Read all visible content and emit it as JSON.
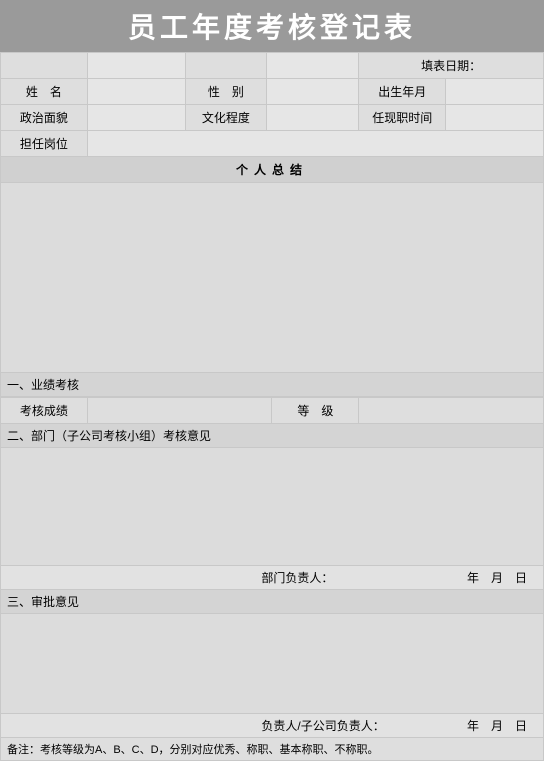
{
  "title": "员工年度考核登记表",
  "fillDateHeader": "填表日期：",
  "info": {
    "nameLabel": "姓　名",
    "genderLabel": "性　别",
    "birthLabel": "出生年月",
    "politicsLabel": "政治面貌",
    "educationLabel": "文化程度",
    "tenureLabel": "任现职时间",
    "positionLabel": "担任岗位",
    "nameValue": "",
    "genderValue": "",
    "birthValue": "",
    "politicsValue": "",
    "educationValue": "",
    "tenureValue": "",
    "positionValue": ""
  },
  "summaryHeader": "个人总结",
  "section1": {
    "header": "一、业绩考核",
    "scoreLabel": "考核成绩",
    "scoreValue": "",
    "gradeLabel": "等　级",
    "gradeValue": ""
  },
  "section2": {
    "header": "二、部门（子公司考核小组）考核意见",
    "signerLabel": "部门负责人：",
    "dateLabel": "年　月　日"
  },
  "section3": {
    "header": "三、审批意见",
    "signerLabel": "负责人/子公司负责人：",
    "dateLabel": "年　月　日"
  },
  "remark": "备注：考核等级为A、B、C、D，分别对应优秀、称职、基本称职、不称职。"
}
